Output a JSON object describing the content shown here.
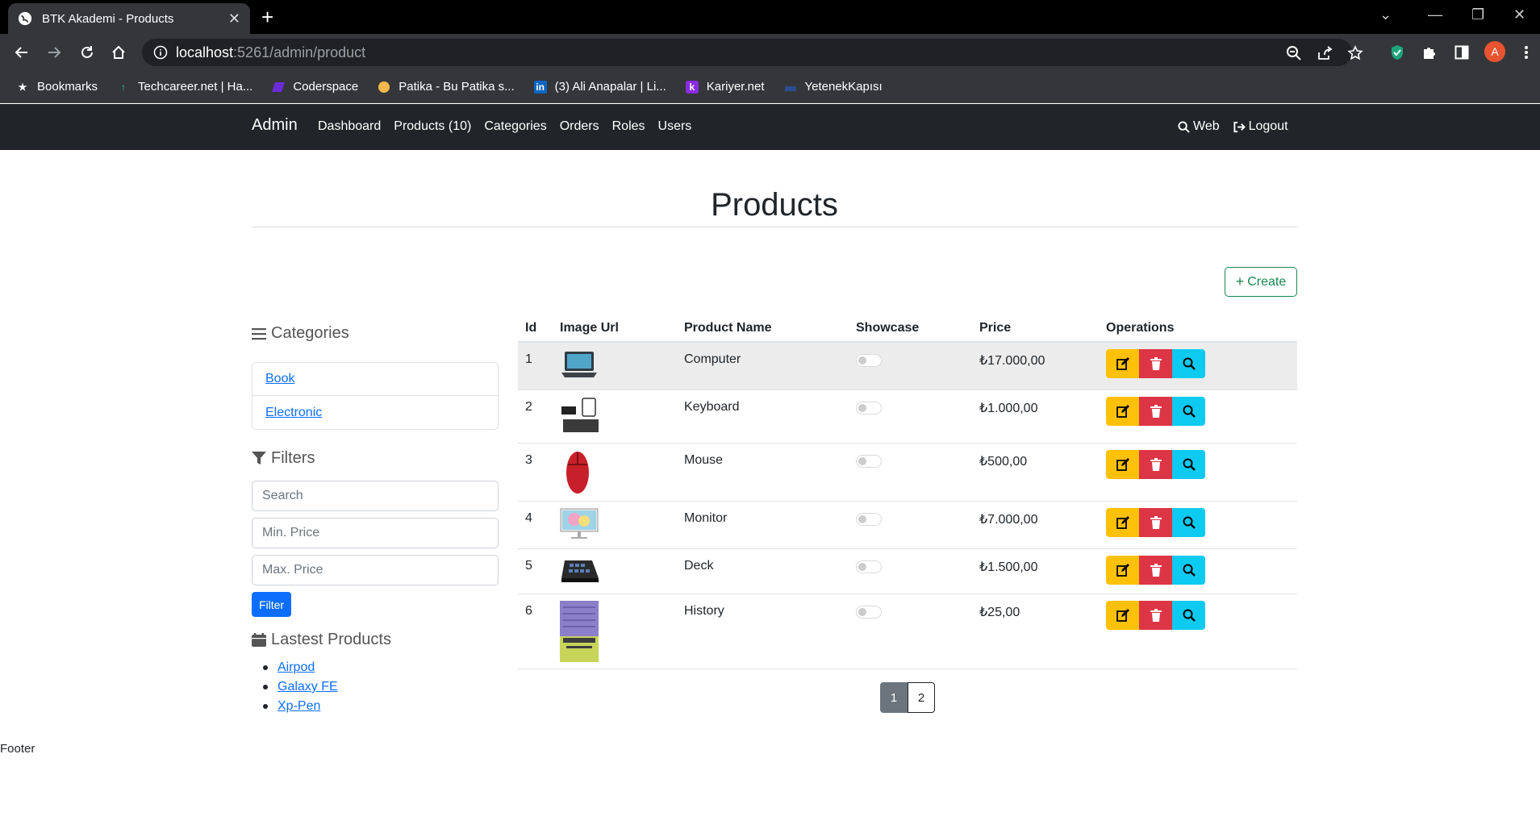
{
  "browser": {
    "tab_title": "BTK Akademi - Products",
    "url_host": "localhost",
    "url_rest": ":5261/admin/product",
    "avatar_letter": "A",
    "bookmarks": [
      {
        "label": "Bookmarks",
        "icon": "star-icon"
      },
      {
        "label": "Techcareer.net | Ha...",
        "icon": "techcareer-icon"
      },
      {
        "label": "Coderspace",
        "icon": "coderspace-icon"
      },
      {
        "label": "Patika - Bu Patika s...",
        "icon": "patika-icon"
      },
      {
        "label": "(3) Ali Anapalar | Li...",
        "icon": "linkedin-icon"
      },
      {
        "label": "Kariyer.net",
        "icon": "kariyer-icon"
      },
      {
        "label": "YetenekKapısı",
        "icon": "yetenek-icon"
      }
    ]
  },
  "nav": {
    "brand": "Admin",
    "links": [
      "Dashboard",
      "Products (10)",
      "Categories",
      "Orders",
      "Roles",
      "Users"
    ],
    "web": "Web",
    "logout": "Logout"
  },
  "page": {
    "title": "Products",
    "create_label": "Create"
  },
  "sidebar": {
    "categories_title": "Categories",
    "categories": [
      "Book",
      "Electronic"
    ],
    "filters_title": "Filters",
    "search_placeholder": "Search",
    "min_price_placeholder": "Min. Price",
    "max_price_placeholder": "Max. Price",
    "filter_button": "Filter",
    "latest_title": "Lastest Products",
    "latest": [
      "Airpod",
      "Galaxy FE",
      "Xp-Pen"
    ]
  },
  "table": {
    "headers": [
      "Id",
      "Image Url",
      "Product Name",
      "Showcase",
      "Price",
      "Operations"
    ],
    "rows": [
      {
        "id": "1",
        "name": "Computer",
        "showcase": false,
        "price": "₺17.000,00",
        "image": "laptop"
      },
      {
        "id": "2",
        "name": "Keyboard",
        "showcase": false,
        "price": "₺1.000,00",
        "image": "keyboard"
      },
      {
        "id": "3",
        "name": "Mouse",
        "showcase": false,
        "price": "₺500,00",
        "image": "mouse"
      },
      {
        "id": "4",
        "name": "Monitor",
        "showcase": false,
        "price": "₺7.000,00",
        "image": "monitor"
      },
      {
        "id": "5",
        "name": "Deck",
        "showcase": false,
        "price": "₺1.500,00",
        "image": "deck"
      },
      {
        "id": "6",
        "name": "History",
        "showcase": false,
        "price": "₺25,00",
        "image": "book"
      }
    ]
  },
  "pagination": [
    "1",
    "2"
  ],
  "footer": "Footer",
  "colors": {
    "navbar": "#212529",
    "edit": "#ffc107",
    "delete": "#dc3545",
    "view": "#0dcaf0",
    "create": "#198754",
    "primary": "#0d6efd"
  }
}
